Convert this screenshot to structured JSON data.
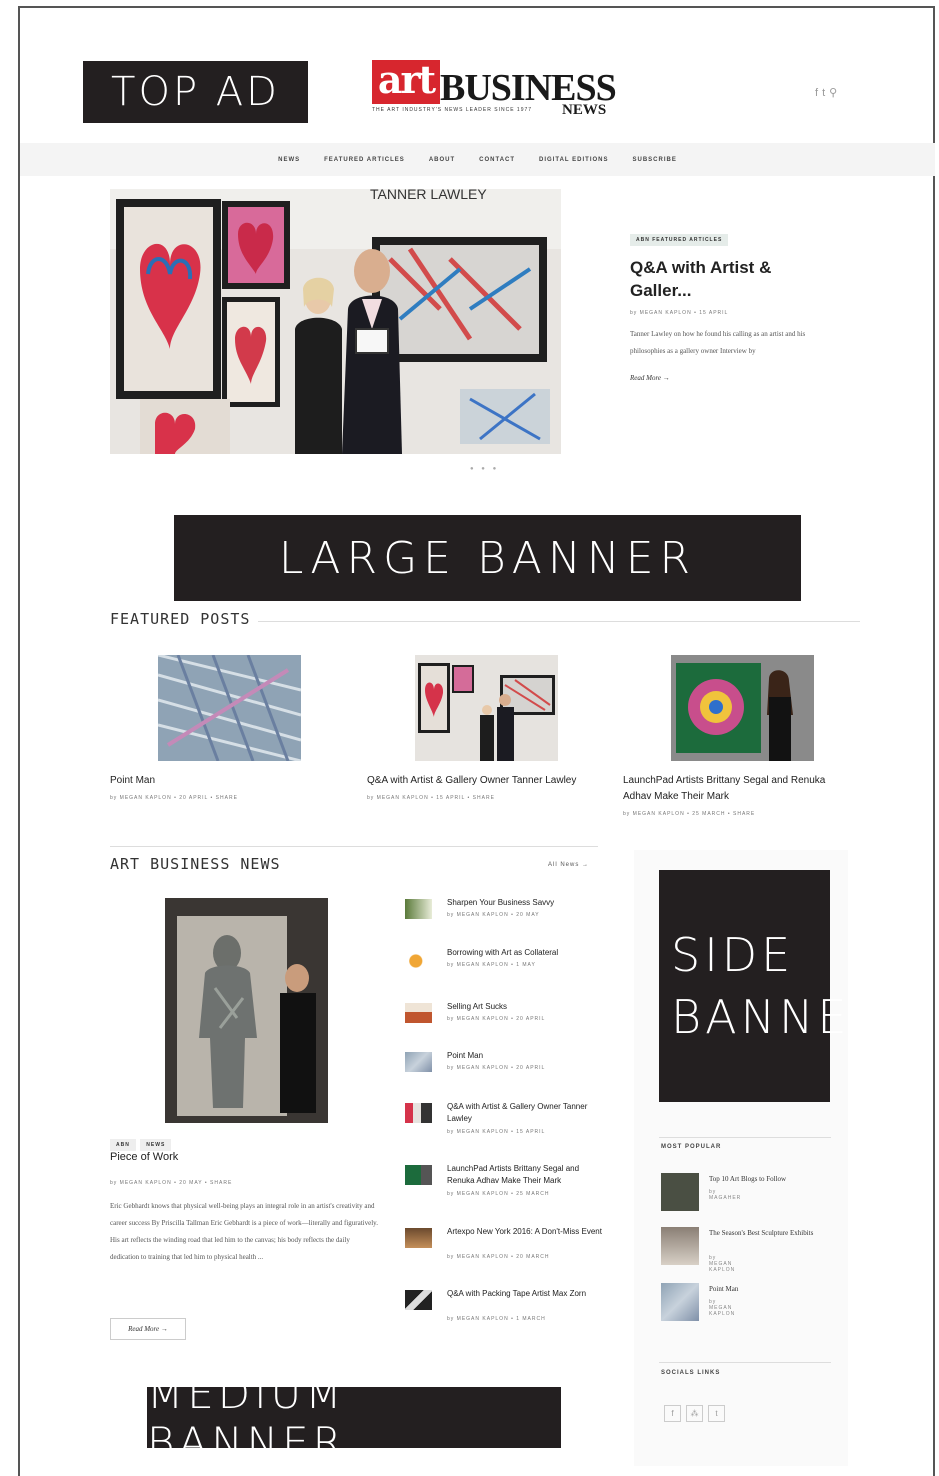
{
  "ads": {
    "top": "TOP AD",
    "large": "LARGE BANNER",
    "side_line1": "SIDE",
    "side_line2": "BANNER",
    "medium": "MEDIUM BANNER"
  },
  "logo": {
    "art": "art",
    "business": "BUSINESS",
    "news": "NEWS",
    "tagline": "THE ART INDUSTRY'S NEWS LEADER SINCE 1977"
  },
  "header": {
    "social_icons": [
      "facebook-icon",
      "twitter-icon",
      "search-icon"
    ]
  },
  "nav": [
    "NEWS",
    "FEATURED ARTICLES",
    "ABOUT",
    "CONTACT",
    "DIGITAL EDITIONS",
    "SUBSCRIBE"
  ],
  "hero": {
    "image_caption": "TANNER LAWLEY",
    "tag": "ABN FEATURED ARTICLES",
    "title": "Q&A with Artist & Galler...",
    "meta": "by MEGAN KAPLON  •  15 APRIL",
    "excerpt": "Tanner Lawley on how he found his calling as an artist and his philosophies as a gallery owner Interview by",
    "read_more": "Read More →"
  },
  "featured": {
    "heading": "FEATURED POSTS",
    "posts": [
      {
        "title": "Point Man",
        "meta": "by MEGAN KAPLON  •  20 APRIL  •  SHARE"
      },
      {
        "title": "Q&A with Artist & Gallery Owner Tanner Lawley",
        "meta": "by MEGAN KAPLON  •  15 APRIL  •  SHARE"
      },
      {
        "title": "LaunchPad Artists Brittany Segal and Renuka Adhav Make Their Mark",
        "meta": "by MEGAN KAPLON  •  25 MARCH  •  SHARE"
      }
    ]
  },
  "abn": {
    "heading": "ART BUSINESS NEWS",
    "all_news": "All News →",
    "main": {
      "tags": [
        "ABN",
        "NEWS"
      ],
      "title": "Piece of Work",
      "meta": "by MEGAN KAPLON  •  20 MAY  •  SHARE",
      "excerpt": "Eric Gebhardt knows that physical well-being plays an integral role in an artist's creativity and career success By Priscilla Tallman Eric Gebhardt is a piece of work—literally and figuratively. His art reflects the winding road that led him to the canvas; his body reflects the daily dedication to training that led him to physical health ...",
      "read_more": "Read More →"
    },
    "list": [
      {
        "title": "Sharpen Your Business Savvy",
        "meta": "by MEGAN KAPLON  •  20 MAY"
      },
      {
        "title": "Borrowing with Art as Collateral",
        "meta": "by MEGAN KAPLON  •  1 MAY"
      },
      {
        "title": "Selling Art Sucks",
        "meta": "by MEGAN KAPLON  •  20 APRIL"
      },
      {
        "title": "Point Man",
        "meta": "by MEGAN KAPLON  •  20 APRIL"
      },
      {
        "title": "Q&A with Artist & Gallery Owner Tanner Lawley",
        "meta": "by MEGAN KAPLON  •  15 APRIL"
      },
      {
        "title": "LaunchPad Artists Brittany Segal and Renuka Adhav Make Their Mark",
        "meta": "by MEGAN KAPLON  •  25 MARCH"
      },
      {
        "title": "Artexpo New York 2016: A Don't-Miss Event",
        "meta": "by MEGAN KAPLON  •  20 MARCH"
      },
      {
        "title": "Q&A with Packing Tape Artist Max Zorn",
        "meta": "by MEGAN KAPLON  •  1 MARCH"
      }
    ]
  },
  "sidebar": {
    "most_popular_heading": "MOST POPULAR",
    "popular": [
      {
        "title": "Top 10 Art Blogs to Follow",
        "meta": "by MAGAHER"
      },
      {
        "title": "The Season's Best Sculpture Exhibits",
        "meta": "by MEGAN KAPLON"
      },
      {
        "title": "Point Man",
        "meta": "by MEGAN KAPLON"
      }
    ],
    "social_heading": "SOCIALS LINKS",
    "social_buttons": [
      "f",
      "⁂",
      "t"
    ]
  }
}
